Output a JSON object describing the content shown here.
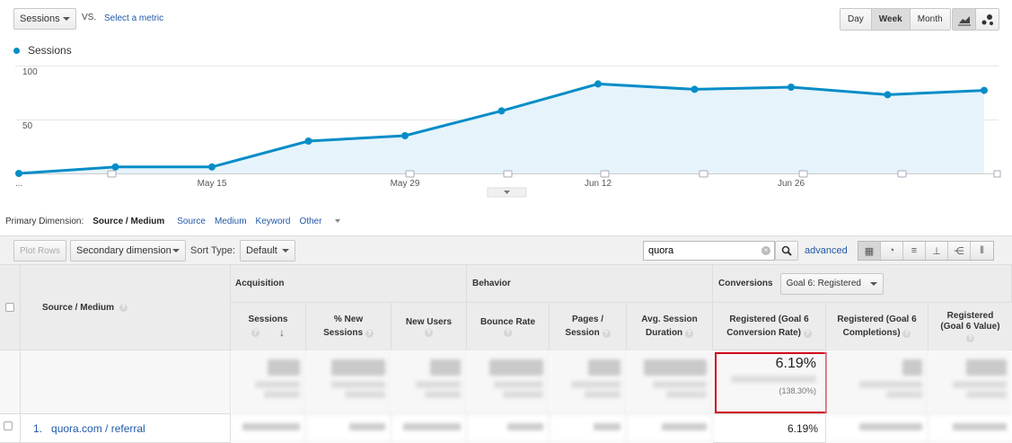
{
  "metric_selector": {
    "value": "Sessions",
    "vs": "VS.",
    "select_metric": "Select a metric"
  },
  "granularity": {
    "options": [
      "Day",
      "Week",
      "Month"
    ],
    "active": "Week"
  },
  "legend": {
    "label": "Sessions",
    "color": "#058dc7"
  },
  "chart_data": {
    "type": "area",
    "series": [
      {
        "name": "Sessions",
        "values": [
          0,
          6,
          6,
          30,
          35,
          58,
          83,
          78,
          80,
          73,
          77
        ]
      }
    ],
    "x": [
      "...",
      "",
      "May 15",
      "",
      "May 29",
      "",
      "Jun 12",
      "",
      "Jun 26",
      "",
      ""
    ],
    "x_tick_labels": [
      "...",
      "May 15",
      "May 29",
      "Jun 12",
      "Jun 26"
    ],
    "y_ticks": [
      "50",
      "100"
    ],
    "ylim": [
      0,
      100
    ],
    "colors": {
      "line": "#058dc7",
      "fill": "#e6f3fa"
    }
  },
  "primary_dimension": {
    "label": "Primary Dimension:",
    "active": "Source / Medium",
    "others": [
      "Source",
      "Medium",
      "Keyword"
    ],
    "other_menu": "Other"
  },
  "toolbar": {
    "plot_rows": "Plot Rows",
    "secondary_dimension": "Secondary dimension",
    "sort_type_label": "Sort Type:",
    "sort_type_value": "Default",
    "search_value": "quora",
    "advanced": "advanced"
  },
  "table": {
    "dimension_header": "Source / Medium",
    "groups": {
      "acquisition": "Acquisition",
      "behavior": "Behavior",
      "conversions": "Conversions",
      "goal_select": "Goal 6: Registered"
    },
    "columns": {
      "sessions": [
        "Sessions"
      ],
      "new_sessions": [
        "% New",
        "Sessions"
      ],
      "new_users": [
        "New Users"
      ],
      "bounce_rate": [
        "Bounce Rate"
      ],
      "pages_session": [
        "Pages /",
        "Session"
      ],
      "avg_duration": [
        "Avg. Session",
        "Duration"
      ],
      "conv_rate": [
        "Registered (Goal 6",
        "Conversion Rate)"
      ],
      "completions": [
        "Registered (Goal 6",
        "Completions)"
      ],
      "value": [
        "Registered",
        "(Goal 6 Value)"
      ]
    },
    "totals": {
      "conv_rate": "6.19%",
      "conv_rate_pct": "(138.30%)"
    },
    "rows": [
      {
        "index": "1.",
        "source": "quora.com / referral",
        "conv_rate": "6.19%"
      }
    ]
  },
  "highlight_color": "#d0021b"
}
